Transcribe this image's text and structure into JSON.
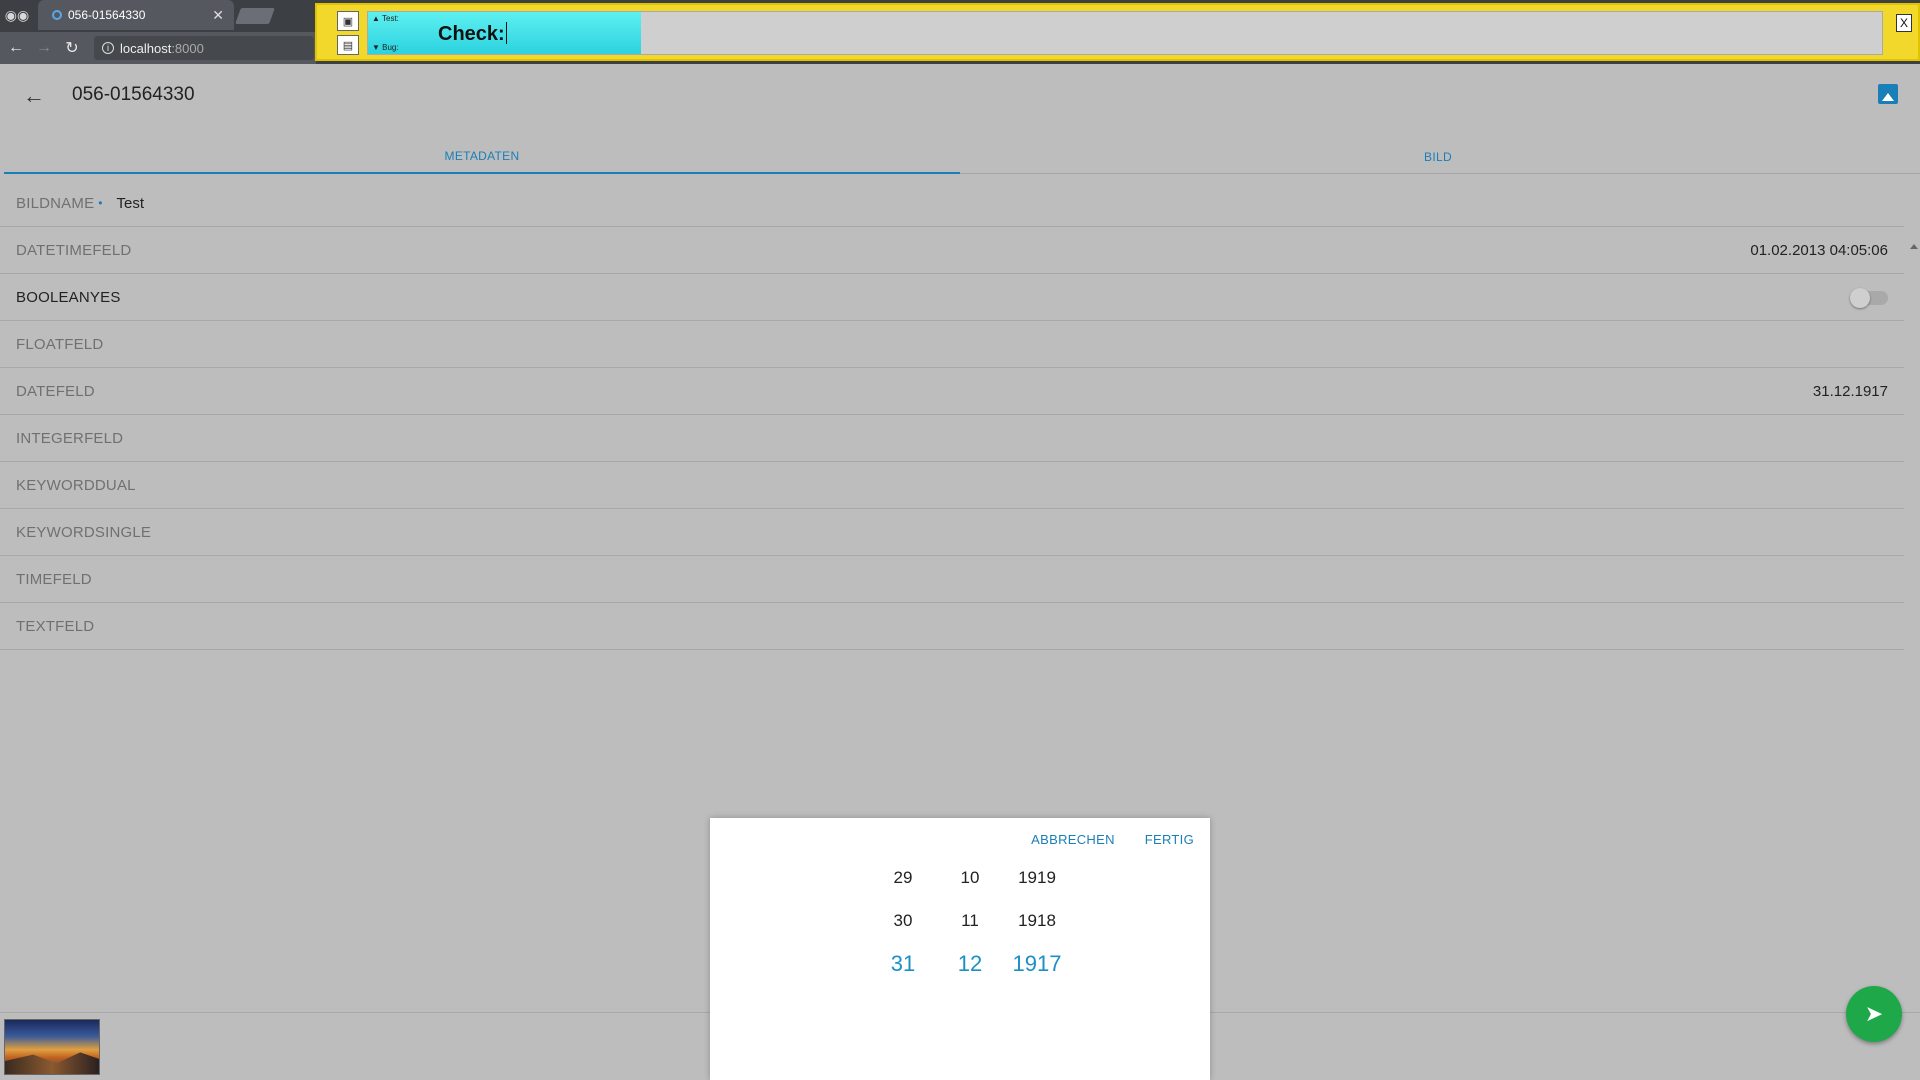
{
  "browser": {
    "tab_title": "056-01564330",
    "address_host": "localhost",
    "address_port": ":8000"
  },
  "extension": {
    "test_label": "▲ Test:",
    "bug_label": "▼ Bug:",
    "check_label": "Check:",
    "close_label": "X",
    "progress": 0.18
  },
  "app": {
    "title": "056-01564330",
    "tabs": [
      {
        "label": "METADATEN",
        "active": true
      },
      {
        "label": "BILD",
        "active": false
      }
    ],
    "fields": [
      {
        "label": "BILDNAME",
        "required_marker": "•",
        "value": "Test"
      },
      {
        "label": "DATETIMEFELD",
        "value": "01.02.2013 04:05:06"
      },
      {
        "label": "BOOLEANYES",
        "toggle": false
      },
      {
        "label": "FLOATFELD",
        "value": ""
      },
      {
        "label": "DATEFELD",
        "value": "31.12.1917"
      },
      {
        "label": "INTEGERFELD",
        "value": ""
      },
      {
        "label": "KEYWORDDUAL",
        "value": ""
      },
      {
        "label": "KEYWORDSINGLE",
        "value": ""
      },
      {
        "label": "TIMEFELD",
        "value": ""
      },
      {
        "label": "TEXTFELD",
        "value": ""
      }
    ]
  },
  "picker": {
    "cancel_label": "ABBRECHEN",
    "done_label": "FERTIG",
    "days": [
      "29",
      "30",
      "31"
    ],
    "months": [
      "10",
      "11",
      "12"
    ],
    "years": [
      "1919",
      "1918",
      "1917"
    ],
    "selected_day": "31",
    "selected_month": "12",
    "selected_year": "1917"
  },
  "colors": {
    "accent": "#1a7fb8",
    "fab": "#1fa84a",
    "overlay_yellow": "#f2d82a"
  }
}
